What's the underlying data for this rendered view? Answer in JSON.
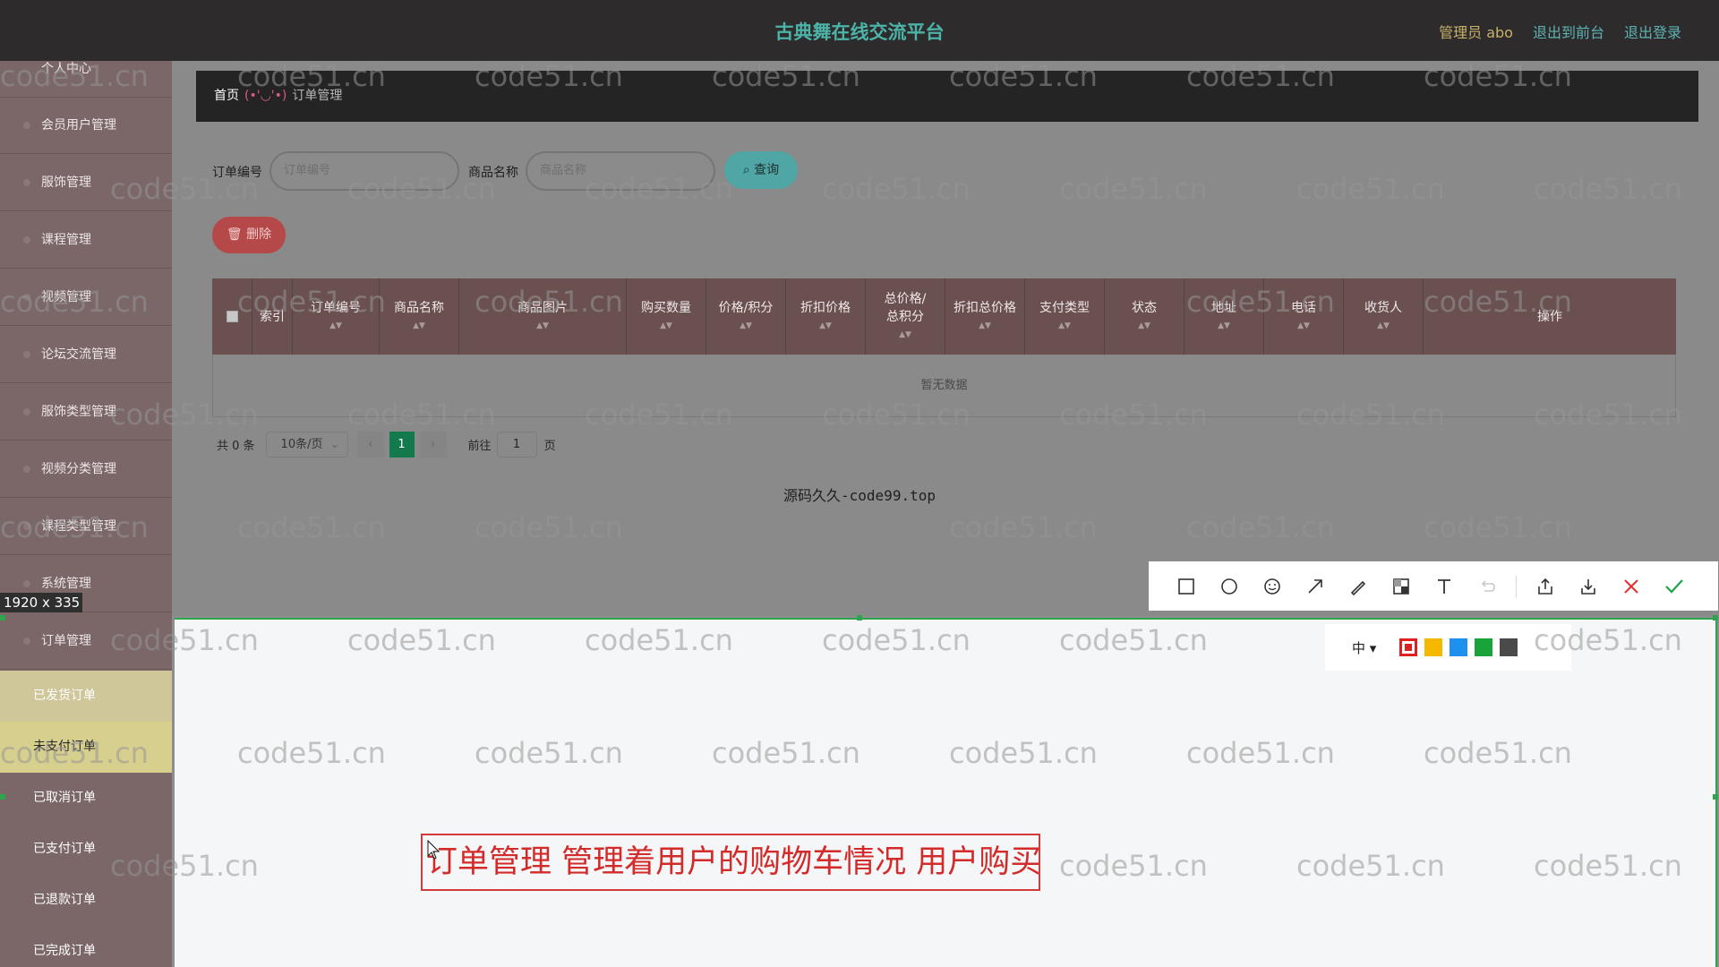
{
  "header": {
    "title": "古典舞在线交流平台",
    "admin_label": "管理员 abo",
    "goto_front": "退出到前台",
    "logout": "退出登录"
  },
  "sidebar": {
    "items": [
      {
        "label": "个人中心"
      },
      {
        "label": "会员用户管理"
      },
      {
        "label": "服饰管理"
      },
      {
        "label": "课程管理"
      },
      {
        "label": "视频管理"
      },
      {
        "label": "论坛交流管理"
      },
      {
        "label": "服饰类型管理"
      },
      {
        "label": "视频分类管理"
      },
      {
        "label": "课程类型管理"
      },
      {
        "label": "系统管理"
      },
      {
        "label": "订单管理"
      }
    ],
    "sub_items": [
      {
        "label": "已发货订单",
        "color": "#cfc79a",
        "text_color": "#ffffff"
      },
      {
        "label": "未支付订单",
        "color": "#d6cf8e",
        "text_color": "#2a2a2a"
      },
      {
        "label": "已取消订单"
      },
      {
        "label": "已支付订单"
      },
      {
        "label": "已退款订单"
      },
      {
        "label": "已完成订单"
      }
    ]
  },
  "breadcrumb": {
    "home": "首页",
    "emoticon": "(•'◡'•)",
    "current": "订单管理"
  },
  "search": {
    "order_no_label": "订单编号",
    "order_no_placeholder": "订单编号",
    "product_label": "商品名称",
    "product_placeholder": "商品名称",
    "query_button": "查询",
    "delete_button": "删除"
  },
  "table": {
    "headers": [
      "索引",
      "订单编号",
      "商品名称",
      "商品图片",
      "购买数量",
      "价格/积分",
      "折扣价格",
      "总价格/总积分",
      "折扣总价格",
      "支付类型",
      "状态",
      "地址",
      "电话",
      "收货人",
      "操作"
    ],
    "empty_text": "暂无数据"
  },
  "pagination": {
    "total": "共 0 条",
    "page_size": "10条/页",
    "current_page": "1",
    "goto_label": "前往",
    "goto_value": "1",
    "page_unit": "页"
  },
  "footer_note": "源码久久-code99.top",
  "screenshot_tool": {
    "selection_size": "1920 x 335",
    "font_size_option": "中",
    "colors": [
      "#e02020",
      "#f5b800",
      "#1e90ee",
      "#1aa33a",
      "#4a4a4a"
    ],
    "annotation_text": "订单管理 管理着用户的购物车情况 用户购买后"
  },
  "watermark": "code51.cn"
}
